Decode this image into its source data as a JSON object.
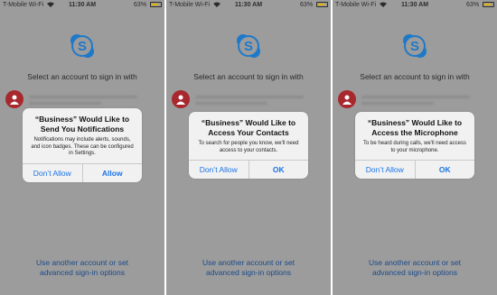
{
  "panels": [
    {
      "status": {
        "carrier": "T-Mobile Wi-Fi",
        "time": "11:30 AM",
        "battery": "63%"
      },
      "select_text": "Select an account to sign in with",
      "alert": {
        "title_line1": "“Business” Would Like to",
        "title_line2": "Send You Notifications",
        "message": "Notifications may include alerts, sounds, and icon badges. These can be configured in Settings.",
        "left_button": "Don’t Allow",
        "right_button": "Allow"
      },
      "link_line1": "Use another account or set",
      "link_line2": "advanced sign-in options"
    },
    {
      "status": {
        "carrier": "T-Mobile Wi-Fi",
        "time": "11:30 AM",
        "battery": "63%"
      },
      "select_text": "Select an account to sign in with",
      "alert": {
        "title_line1": "“Business” Would Like to",
        "title_line2": "Access Your Contacts",
        "message": "To search for people you know, we'll need access to your contacts.",
        "left_button": "Don’t Allow",
        "right_button": "OK"
      },
      "link_line1": "Use another account or set",
      "link_line2": "advanced sign-in options"
    },
    {
      "status": {
        "carrier": "T-Mobile Wi-Fi",
        "time": "11:30 AM",
        "battery": "63%"
      },
      "select_text": "Select an account to sign in with",
      "alert": {
        "title_line1": "“Business” Would Like to",
        "title_line2": "Access the Microphone",
        "message": "To be heard during calls, we'll need access to your microphone.",
        "left_button": "Don’t Allow",
        "right_button": "OK"
      },
      "link_line1": "Use another account or set",
      "link_line2": "advanced sign-in options"
    }
  ],
  "colors": {
    "dim_background": "#9c9c9c",
    "ios_blue": "#1a74e8",
    "skype_blue": "#1f79c9",
    "avatar_red": "#a8282e"
  },
  "battery_level": 0.63
}
